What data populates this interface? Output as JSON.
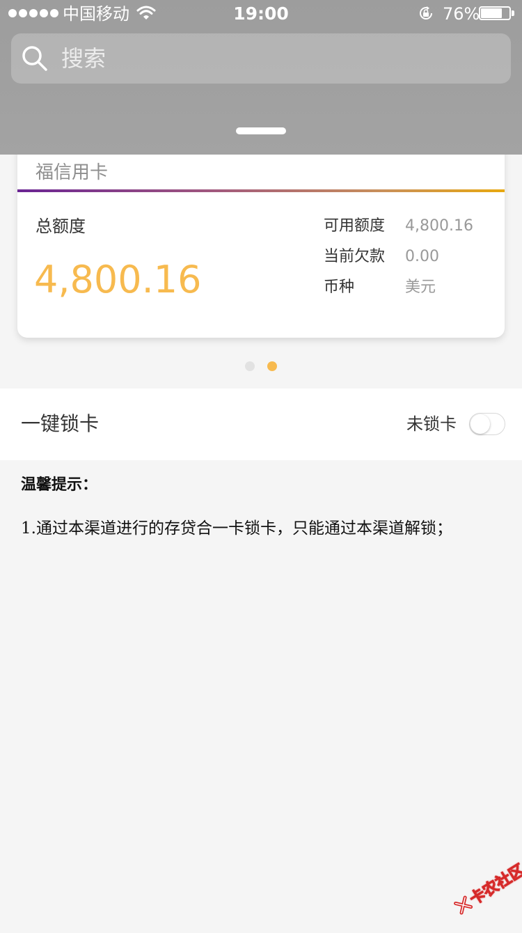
{
  "status_bar": {
    "carrier": "中国移动",
    "time": "19:00",
    "battery_percent": "76%",
    "battery_level": 0.76,
    "icons": [
      "signal-dots",
      "wifi-icon",
      "rotation-lock-icon",
      "battery-icon"
    ]
  },
  "search": {
    "placeholder": "搜索",
    "value": ""
  },
  "card": {
    "name": "福信用卡",
    "total_label": "总额度",
    "total_value": "4,800.16",
    "info": [
      {
        "label": "可用额度",
        "value": "4,800.16"
      },
      {
        "label": "当前欠款",
        "value": "0.00"
      },
      {
        "label": "币种",
        "value": "美元"
      }
    ],
    "accent_color": "#f7ba4f",
    "divider_gradient": [
      "#6a2493",
      "#e8a80f"
    ]
  },
  "pager": {
    "count": 2,
    "active_index": 1
  },
  "lock": {
    "title": "一键锁卡",
    "status": "未锁卡",
    "locked": false
  },
  "tips": {
    "title": "温馨提示：",
    "lines": [
      "1.通过本渠道进行的存贷合一卡锁卡，只能通过本渠道解锁；"
    ]
  },
  "watermark": {
    "text": "卡农社区"
  }
}
